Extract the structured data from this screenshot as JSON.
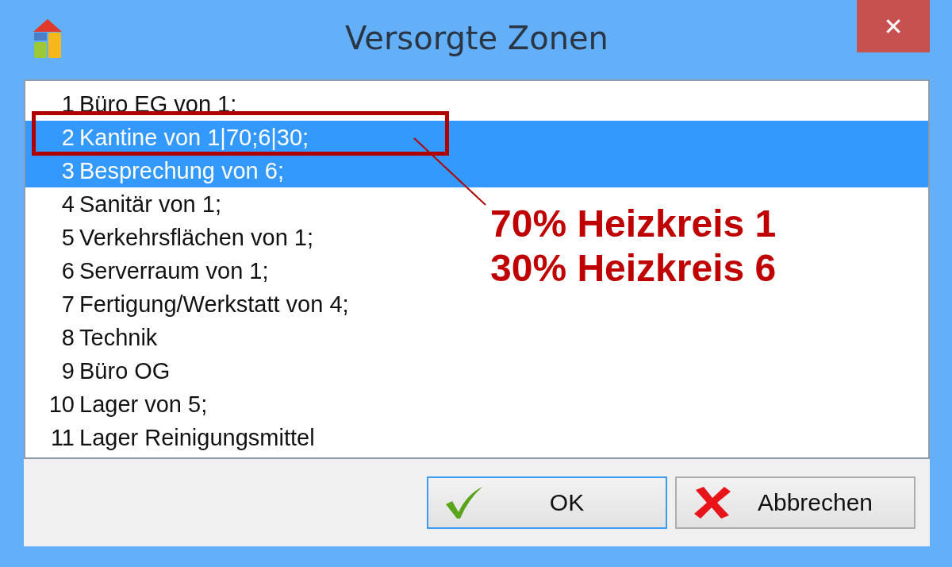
{
  "window": {
    "title": "Versorgte Zonen",
    "close": "✕"
  },
  "list": [
    {
      "number": "1",
      "label": "Büro EG von 1;",
      "selected": false
    },
    {
      "number": "2",
      "label": "Kantine von 1|70;6|30;",
      "selected": true
    },
    {
      "number": "3",
      "label": "Besprechung von 6;",
      "selected": true
    },
    {
      "number": "4",
      "label": "Sanitär von 1;",
      "selected": false
    },
    {
      "number": "5",
      "label": "Verkehrsflächen von 1;",
      "selected": false
    },
    {
      "number": "6",
      "label": "Serverraum von 1;",
      "selected": false
    },
    {
      "number": "7",
      "label": "Fertigung/Werkstatt von 4;",
      "selected": false
    },
    {
      "number": "8",
      "label": "Technik",
      "selected": false
    },
    {
      "number": "9",
      "label": "Büro OG",
      "selected": false
    },
    {
      "number": "10",
      "label": "Lager von 5;",
      "selected": false
    },
    {
      "number": "11",
      "label": "Lager Reinigungsmittel",
      "selected": false
    }
  ],
  "annotation": {
    "lines": [
      "70% Heizkreis 1",
      "30% Heizkreis 6"
    ]
  },
  "buttons": [
    {
      "kind": "ok",
      "label": "OK",
      "default": true
    },
    {
      "kind": "cancel",
      "label": "Abbrechen",
      "default": false
    }
  ]
}
